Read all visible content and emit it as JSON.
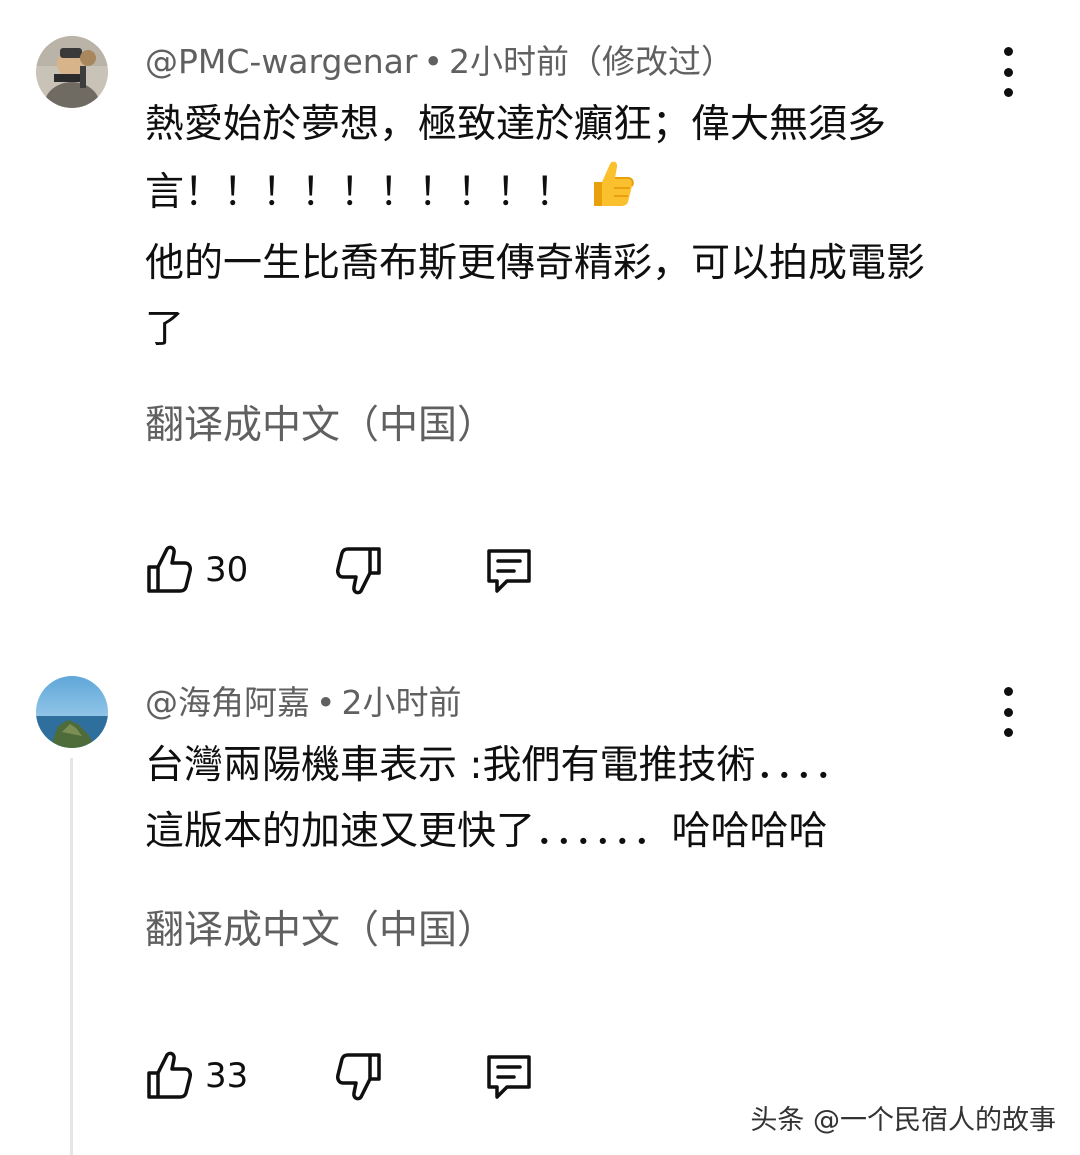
{
  "comments": [
    {
      "author": "@PMC-wargenar",
      "dot": "•",
      "time": "2小时前（修改过）",
      "lines": [
        "熱愛始於夢想，極致達於癲狂；偉大無須多",
        "言！！！！！！！！！！",
        "他的一生比喬布斯更傳奇精彩，可以拍成電影",
        "了"
      ],
      "emoji": "👍",
      "translate": "翻译成中文（中国）",
      "likes": "30"
    },
    {
      "author": "@海角阿嘉",
      "dot": "•",
      "time": "2小时前",
      "lines": [
        "台灣兩陽機車表示 :我們有電推技術．．．．",
        "這版本的加速又更快了．．．．．．哈哈哈哈"
      ],
      "translate": "翻译成中文（中国）",
      "likes": "33"
    }
  ],
  "watermark": "头条 @一个民宿人的故事",
  "icons": {
    "like": "thumb-up-icon",
    "dislike": "thumb-down-icon",
    "reply": "reply-comment-icon",
    "more": "more-vertical-icon"
  },
  "colors": {
    "text": "#0f0f0f",
    "secondary": "#606060",
    "thread": "#e5e5e5"
  }
}
